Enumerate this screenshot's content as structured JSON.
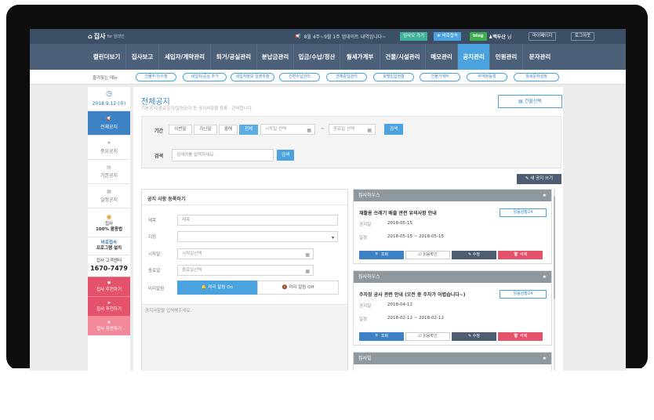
{
  "topbar": {
    "logo": "집사",
    "logo_sub": "for 임대인",
    "notice": "8월 4주~9월 1주 업데이트 내역입니다~",
    "btn_old": "임사오 가기",
    "btn_fav": "★ 바로접속",
    "btn_blog": "blog",
    "user": "♟백두산",
    "user_suffix": "님",
    "btn_mypage": "마이페이지",
    "btn_logout": "로그아웃"
  },
  "mainnav": [
    "캘린더보기",
    "집사보고",
    "세입자/계약관리",
    "퇴거/공실관리",
    "분납금관리",
    "입금/수납/정산",
    "월세가계부",
    "건물/시설관리",
    "메모관리",
    "공지관리",
    "민원관리",
    "문자관리"
  ],
  "subnav": {
    "label": "즐겨찾는 메뉴",
    "chips": [
      "건물추가/수정",
      "세입자/공실 추가",
      "세입자정보 일괄수정",
      "간편수납관리",
      "연체중입관리",
      "호별입입현황",
      "건물가계부",
      "부계정등록",
      "월세문자설정"
    ]
  },
  "sidebar": {
    "date": "2018.9.12 (수)",
    "items": [
      "전체공지",
      "중요공지",
      "기본공지",
      "일정공지"
    ],
    "ad1": [
      "집사",
      "100% 활용법"
    ],
    "ad2": [
      "바로접속",
      "프로그램 설치"
    ],
    "ad3": [
      "집사 고객센터",
      "1670-7479"
    ],
    "red": [
      "집사 추천하기",
      "집사 추천하기",
      "집사 칭찬하기"
    ]
  },
  "page": {
    "title": "전체공지",
    "desc": "기본공지/중요공지/일정공지 등 공지사항을 등록 · 관리합니다.",
    "building_btn": "건물선택",
    "new_btn": "새 공지 쓰기"
  },
  "filter": {
    "period_label": "기간",
    "periods": [
      "이번달",
      "지난달",
      "올해",
      "전체"
    ],
    "start_ph": "시작일 선택",
    "tilde": "~",
    "end_ph": "종료일 선택",
    "search_btn": "검색",
    "keyword_label": "검색",
    "keyword_ph": "검색어를 입력하세요.",
    "keyword_btn": "검색"
  },
  "form": {
    "title": "공지 사항 등록하기",
    "l_title": "제목",
    "ph_title": "제목",
    "l_build": "지정",
    "l_start": "시작일",
    "ph_start": "시작일선택",
    "l_end": "종료일",
    "ph_end": "종료일선택",
    "l_alarm": "미리알림",
    "alarm_on": "미리 알림 On",
    "alarm_off": "미리 알림 Off",
    "body_ph": "공지사항을 입력해주세요."
  },
  "cards": [
    {
      "head": "집사하우스",
      "title": "재활용 쓰레기 배출 관련 유의사항 안내",
      "read": "읽음상황24",
      "k1": "공지일",
      "v1": "2018-05-15",
      "k2": "일정",
      "v2": "2018-05-15 ~ 2018-05-15",
      "a1": "조회",
      "a2": "읽음확인",
      "a3": "수정",
      "a4": "삭제"
    },
    {
      "head": "집사하우스",
      "title": "주차장 공사 관련 안내 (오전 중 주차가 어렵습니다~)",
      "read": "읽음상황24",
      "k1": "공지일",
      "v1": "2018-04-12",
      "k2": "일정",
      "v2": "2018-02-12 ~ 2018-02-12",
      "a1": "조회",
      "a2": "읽음확인",
      "a3": "수정",
      "a4": "삭제"
    },
    {
      "head": "집사빌"
    }
  ]
}
